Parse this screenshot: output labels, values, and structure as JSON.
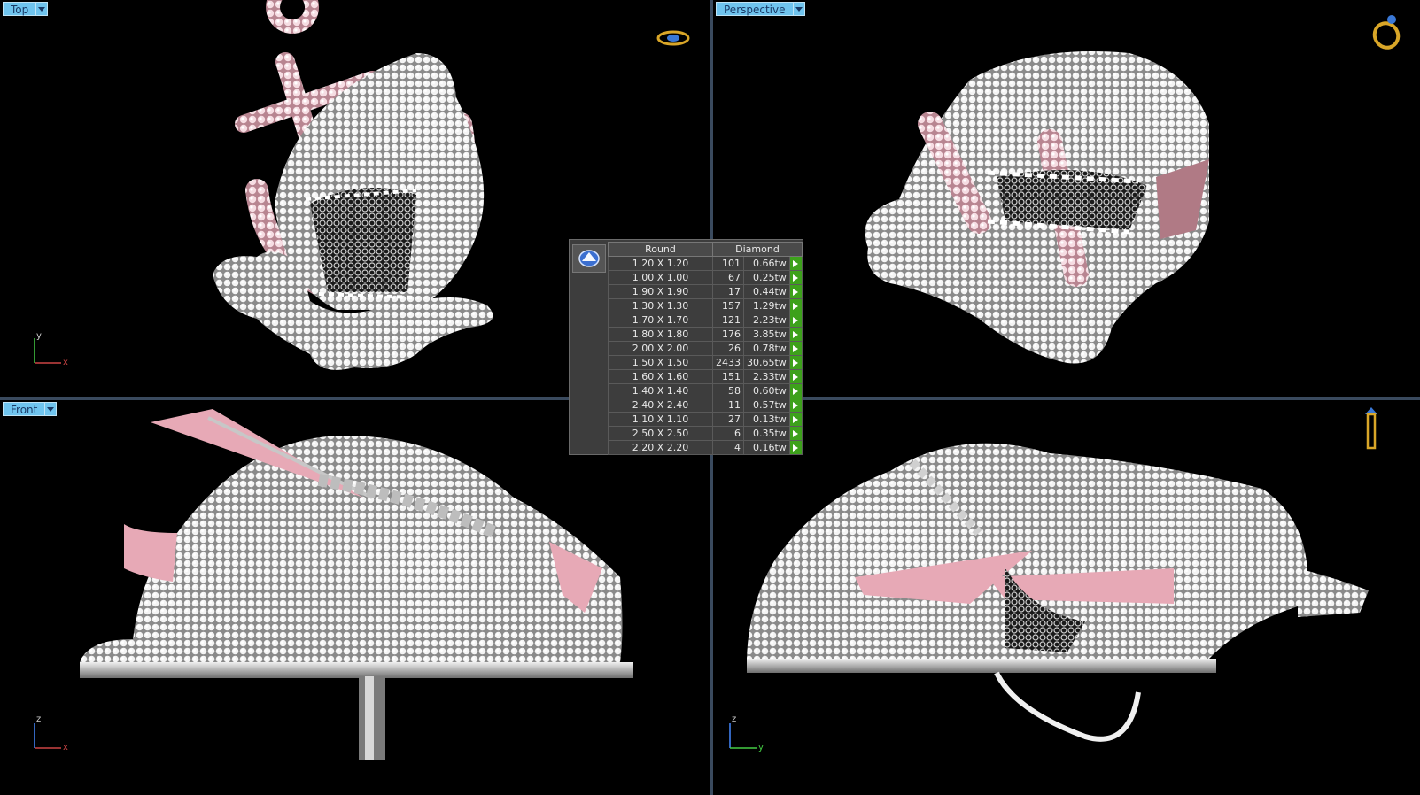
{
  "viewports": {
    "top": {
      "label": "Top",
      "axis_v": "y",
      "axis_h": "x"
    },
    "perspective": {
      "label": "Perspective"
    },
    "front": {
      "label": "Front",
      "axis_v": "z",
      "axis_h": "x"
    },
    "right": {
      "axis_v": "z",
      "axis_h": "y"
    }
  },
  "stone_table": {
    "headers": [
      "Round",
      "Diamond"
    ],
    "rows": [
      {
        "size": "1.20 X 1.20",
        "count": "101",
        "weight": "0.66tw"
      },
      {
        "size": "1.00 X 1.00",
        "count": "67",
        "weight": "0.25tw"
      },
      {
        "size": "1.90 X 1.90",
        "count": "17",
        "weight": "0.44tw"
      },
      {
        "size": "1.30 X 1.30",
        "count": "157",
        "weight": "1.29tw"
      },
      {
        "size": "1.70 X 1.70",
        "count": "121",
        "weight": "2.23tw"
      },
      {
        "size": "1.80 X 1.80",
        "count": "176",
        "weight": "3.85tw"
      },
      {
        "size": "2.00 X 2.00",
        "count": "26",
        "weight": "0.78tw"
      },
      {
        "size": "1.50 X 1.50",
        "count": "2433",
        "weight": "30.65tw"
      },
      {
        "size": "1.60 X 1.60",
        "count": "151",
        "weight": "2.33tw"
      },
      {
        "size": "1.40 X 1.40",
        "count": "58",
        "weight": "0.60tw"
      },
      {
        "size": "2.40 X 2.40",
        "count": "11",
        "weight": "0.57tw"
      },
      {
        "size": "1.10 X 1.10",
        "count": "27",
        "weight": "0.13tw"
      },
      {
        "size": "2.50 X 2.50",
        "count": "6",
        "weight": "0.35tw"
      },
      {
        "size": "2.20 X 2.20",
        "count": "4",
        "weight": "0.16tw"
      }
    ]
  },
  "colors": {
    "viewport_bg": "#000000",
    "divider": "#3a4a5e",
    "label_bg": "#6fc4ee",
    "metal_pink": "#e7a9b6",
    "metal_silver": "#d8d8d8",
    "arrow_green": "#3da11b"
  },
  "icons": {
    "top_corner": "ring-top-icon",
    "perspective_corner": "ring-perspective-icon",
    "right_corner": "ring-side-icon",
    "stone_cell": "gem-icon"
  }
}
